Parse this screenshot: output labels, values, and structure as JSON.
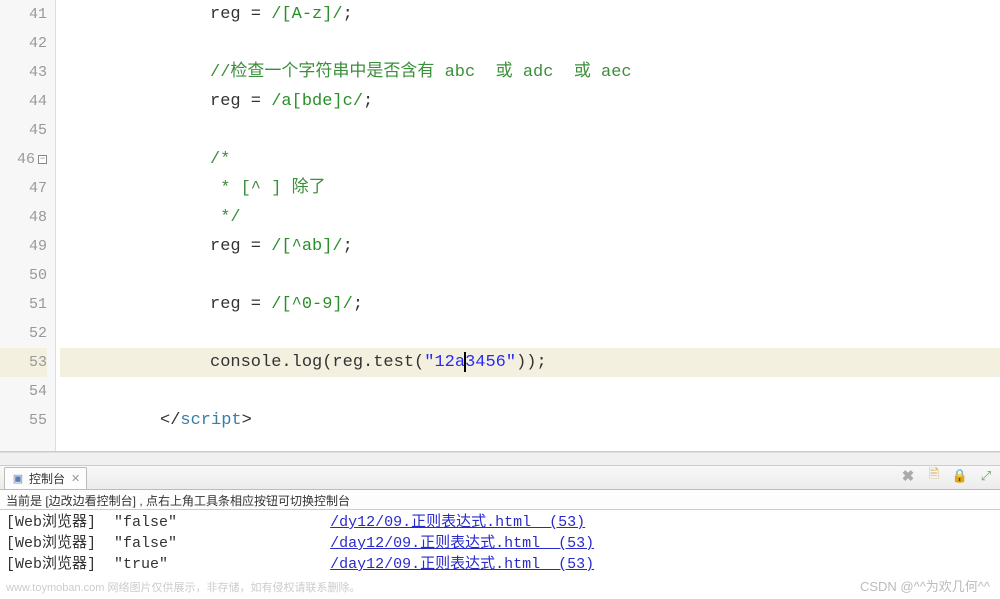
{
  "editor": {
    "lines": [
      {
        "num": "41",
        "tokens": [
          [
            "default",
            "reg = "
          ],
          [
            "regex",
            "/[A-z]/"
          ],
          [
            "default",
            ";"
          ]
        ]
      },
      {
        "num": "42",
        "tokens": []
      },
      {
        "num": "43",
        "tokens": [
          [
            "comment",
            "//检查一个字符串中是否含有 abc  或 adc  或 aec"
          ]
        ]
      },
      {
        "num": "44",
        "tokens": [
          [
            "default",
            "reg = "
          ],
          [
            "regex",
            "/a[bde]c/"
          ],
          [
            "default",
            ";"
          ]
        ]
      },
      {
        "num": "45",
        "tokens": []
      },
      {
        "num": "46",
        "fold": true,
        "tokens": [
          [
            "comment",
            "/*"
          ]
        ]
      },
      {
        "num": "47",
        "tokens": [
          [
            "comment",
            " * [^ ] 除了"
          ]
        ]
      },
      {
        "num": "48",
        "tokens": [
          [
            "comment",
            " */"
          ]
        ]
      },
      {
        "num": "49",
        "tokens": [
          [
            "default",
            "reg = "
          ],
          [
            "regex",
            "/[^ab]/"
          ],
          [
            "default",
            ";"
          ]
        ]
      },
      {
        "num": "50",
        "tokens": []
      },
      {
        "num": "51",
        "tokens": [
          [
            "default",
            "reg = "
          ],
          [
            "regex",
            "/[^0-9]/"
          ],
          [
            "default",
            ";"
          ]
        ]
      },
      {
        "num": "52",
        "tokens": []
      },
      {
        "num": "53",
        "highlight": true,
        "tokens": [
          [
            "default",
            "console.log(reg.test("
          ],
          [
            "str",
            "\"12a"
          ],
          [
            "cursor",
            ""
          ],
          [
            "str",
            "3456\""
          ],
          [
            "default",
            "));"
          ]
        ]
      },
      {
        "num": "54",
        "tokens": []
      },
      {
        "num": "55",
        "closetag": true,
        "tokens": [
          [
            "punct",
            "</"
          ],
          [
            "tagname",
            "script"
          ],
          [
            "punct",
            ">"
          ]
        ]
      }
    ]
  },
  "console_panel": {
    "tab_label": "控制台",
    "hint": "当前是 [边改边看控制台] , 点右上角工具条相应按钮可切换控制台",
    "rows": [
      {
        "source": "[Web浏览器]",
        "value": "\"false\"",
        "link": "/day12/09.正则表达式.html  (53)",
        "link_display_prefix": "/d",
        "link_display_mid": "y12/09.正则表达式.html  (53)"
      },
      {
        "source": "[Web浏览器]",
        "value": "\"false\"",
        "link": "/day12/09.正则表达式.html  (53)"
      },
      {
        "source": "[Web浏览器]",
        "value": "\"true\"",
        "link": "/day12/09.正则表达式.html  (53)"
      }
    ]
  },
  "watermark_right": "CSDN @^^为欢几何^^",
  "watermark_left": "www.toymoban.com 网络图片仅供展示，非存储，如有侵权请联系删除。"
}
